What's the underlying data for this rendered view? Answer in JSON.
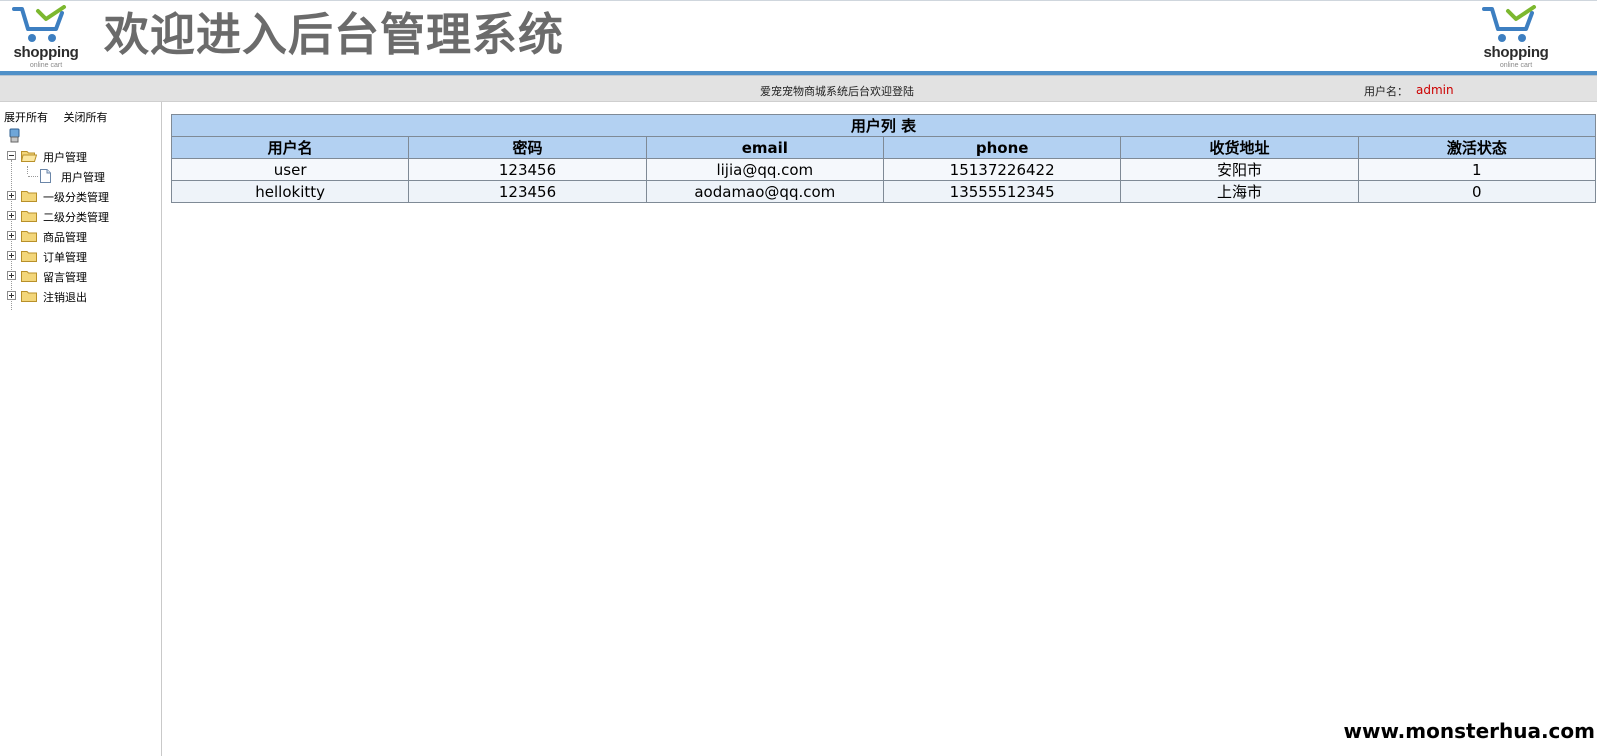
{
  "header": {
    "logo_text": "shopping",
    "logo_subtext": "online cart",
    "title": "欢迎进入后台管理系统"
  },
  "statusbar": {
    "welcome": "爱宠宠物商城系统后台欢迎登陆",
    "user_label": "用户名：",
    "user_value": "admin"
  },
  "sidebar": {
    "expand_all": "展开所有",
    "collapse_all": "关闭所有",
    "items": [
      {
        "label": "用户管理",
        "expanded": true,
        "children": [
          {
            "label": "用户管理"
          }
        ]
      },
      {
        "label": "一级分类管理",
        "expanded": false
      },
      {
        "label": "二级分类管理",
        "expanded": false
      },
      {
        "label": "商品管理",
        "expanded": false
      },
      {
        "label": "订单管理",
        "expanded": false
      },
      {
        "label": "留言管理",
        "expanded": false
      },
      {
        "label": "注销退出",
        "expanded": false
      }
    ]
  },
  "table": {
    "caption": "用户列 表",
    "headers": [
      "用户名",
      "密码",
      "email",
      "phone",
      "收货地址",
      "激活状态"
    ],
    "rows": [
      [
        "user",
        "123456",
        "lijia@qq.com",
        "15137226422",
        "安阳市",
        "1"
      ],
      [
        "hellokitty",
        "123456",
        "aodamao@qq.com",
        "13555512345",
        "上海市",
        "0"
      ]
    ]
  },
  "watermark": "www.monsterhua.com",
  "colors": {
    "accent_blue": "#4f90c8",
    "table_header_bg": "#b3d1f2",
    "user_value": "#cc0000",
    "title_gray": "#6b6b6b"
  }
}
